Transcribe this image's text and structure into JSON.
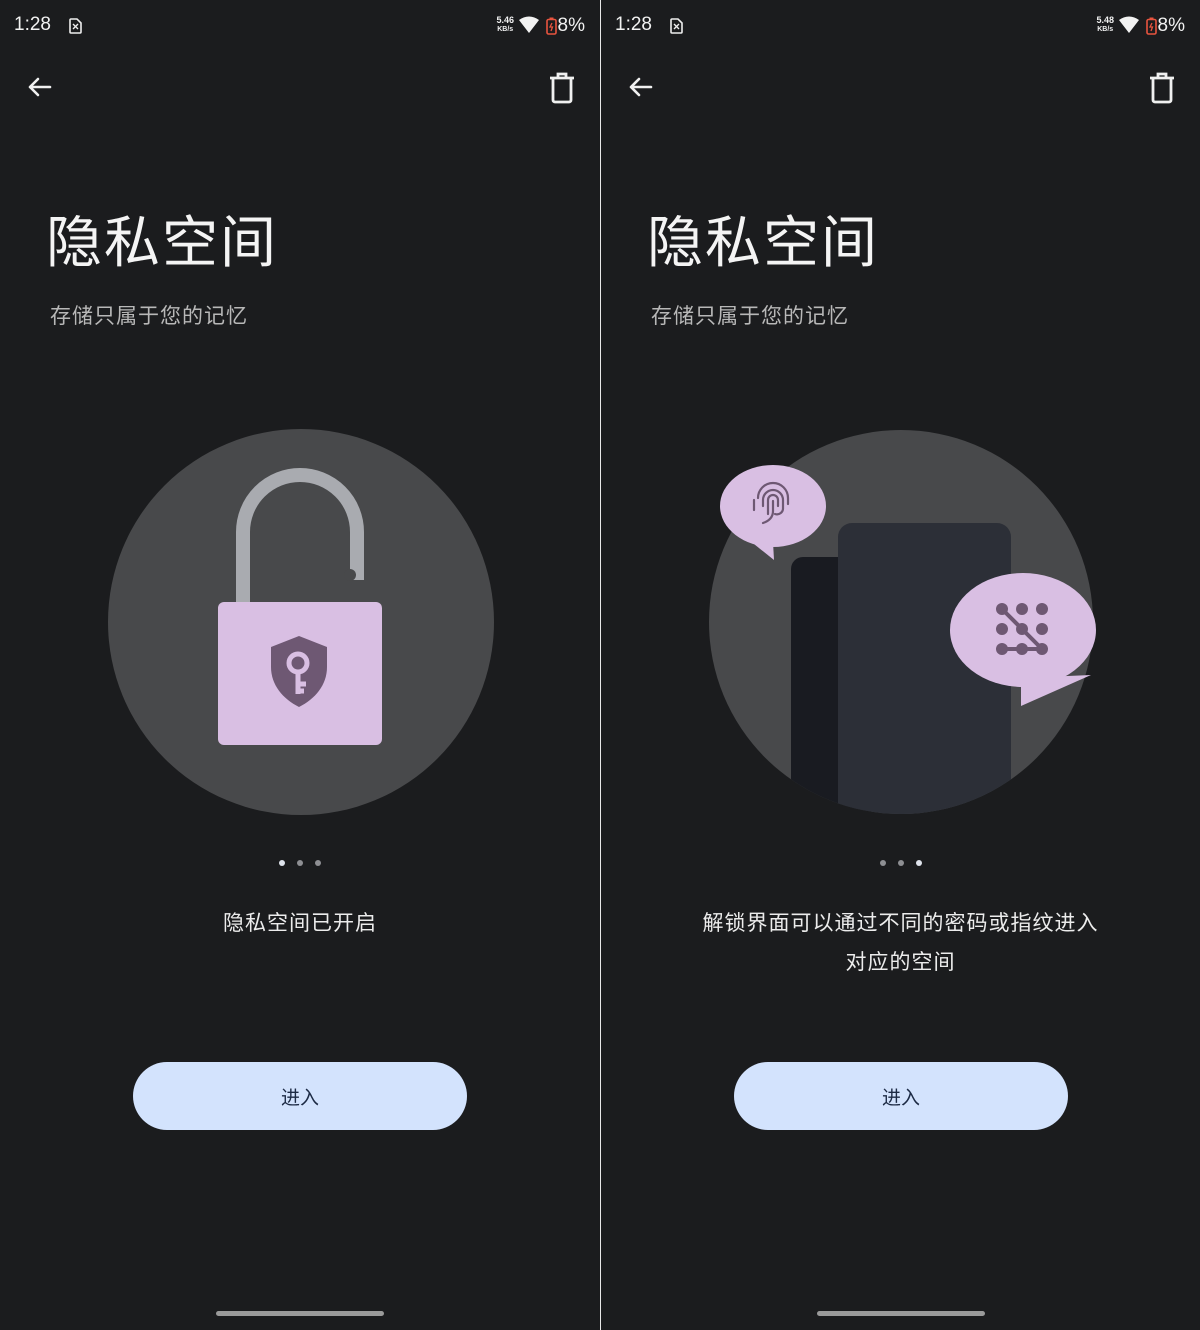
{
  "screens": [
    {
      "status": {
        "time": "1:28",
        "net_speed": "5.46",
        "net_unit": "KB/s",
        "battery": "8%"
      },
      "title": "隐私空间",
      "subtitle": "存储只属于您的记忆",
      "illustration": "padlock-illustration",
      "page_indicator": {
        "count": 3,
        "active": 1
      },
      "caption": "隐私空间已开启",
      "enter_label": "进入"
    },
    {
      "status": {
        "time": "1:28",
        "net_speed": "5.48",
        "net_unit": "KB/s",
        "battery": "8%"
      },
      "title": "隐私空间",
      "subtitle": "存储只属于您的记忆",
      "illustration": "phones-unlock-illustration",
      "page_indicator": {
        "count": 3,
        "active": 3
      },
      "caption": "解锁界面可以通过不同的密码或指纹进入对应的空间",
      "enter_label": "进入"
    }
  ],
  "icons": {
    "back": "arrow-left-icon",
    "delete": "trash-icon",
    "fingerprint": "fingerprint-icon",
    "pattern": "pattern-lock-icon",
    "shield_key": "shield-key-icon"
  },
  "colors": {
    "background": "#1b1c1e",
    "circle": "#48494b",
    "accent_lilac": "#d9bfe3",
    "shield": "#6e5873",
    "button": "#d3e3fd",
    "button_text": "#1c2a44"
  }
}
